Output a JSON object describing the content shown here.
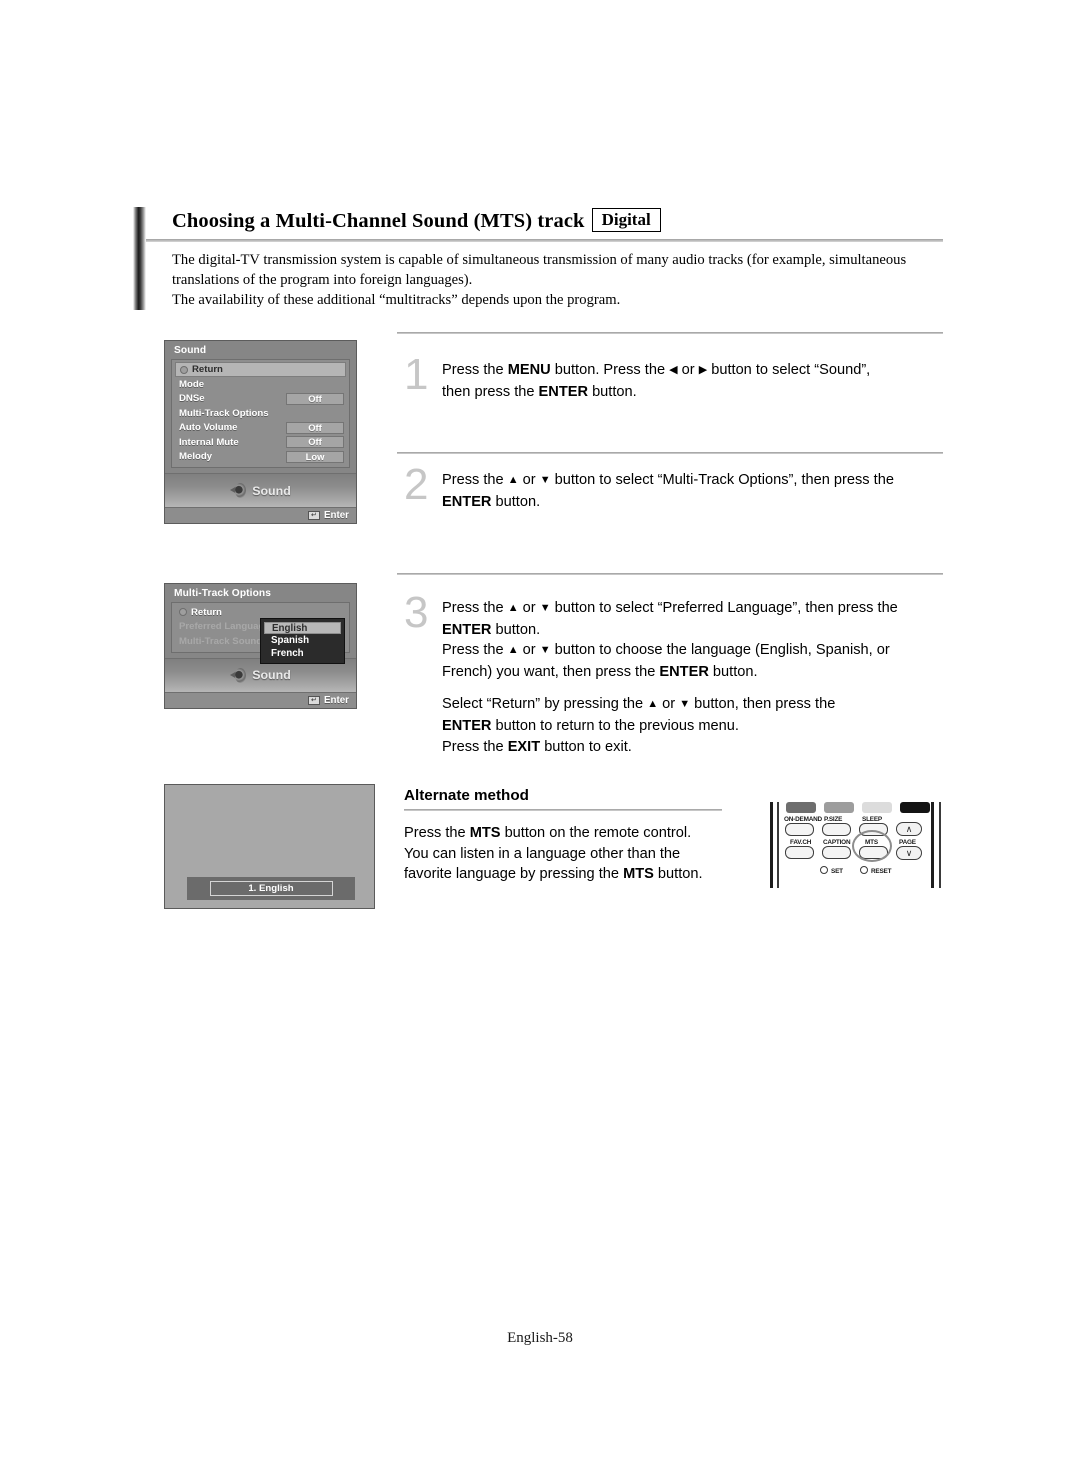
{
  "document": {
    "title": "Choosing a Multi-Channel Sound (MTS) track",
    "badge": "Digital",
    "intro_line1": "The digital-TV transmission system is capable of simultaneous transmission of many audio tracks (for example, simultaneous",
    "intro_line2": "translations of the program into foreign languages).",
    "intro_line3": "The availability of these additional “multitracks” depends upon the program.",
    "footer": "English-58"
  },
  "steps": [
    {
      "number": "1",
      "lines": [
        {
          "parts": [
            {
              "t": "Press the ",
              "b": false
            },
            {
              "t": "MENU",
              "b": true
            },
            {
              "t": " button. Press the ",
              "b": false
            },
            {
              "t": "◀",
              "b": false,
              "arrow": true
            },
            {
              "t": "  or  ",
              "b": false
            },
            {
              "t": "▶",
              "b": false,
              "arrow": true
            },
            {
              "t": "  button to select “Sound”,",
              "b": false
            }
          ]
        },
        {
          "parts": [
            {
              "t": "then press the ",
              "b": false
            },
            {
              "t": "ENTER",
              "b": true
            },
            {
              "t": " button.",
              "b": false
            }
          ]
        }
      ]
    },
    {
      "number": "2",
      "lines": [
        {
          "parts": [
            {
              "t": "Press the ",
              "b": false
            },
            {
              "t": "▲",
              "b": false,
              "arrow": true
            },
            {
              "t": " or ",
              "b": false
            },
            {
              "t": "▼",
              "b": false,
              "arrow": true
            },
            {
              "t": " button to select “Multi-Track Options”, then press the",
              "b": false
            }
          ]
        },
        {
          "parts": [
            {
              "t": "ENTER",
              "b": true
            },
            {
              "t": " button.",
              "b": false
            }
          ]
        }
      ]
    },
    {
      "number": "3",
      "lines": [
        {
          "parts": [
            {
              "t": "Press the ",
              "b": false
            },
            {
              "t": "▲",
              "b": false,
              "arrow": true
            },
            {
              "t": " or ",
              "b": false
            },
            {
              "t": "▼",
              "b": false,
              "arrow": true
            },
            {
              "t": " button to select “Preferred Language”, then press the",
              "b": false
            }
          ]
        },
        {
          "parts": [
            {
              "t": "ENTER",
              "b": true
            },
            {
              "t": " button.",
              "b": false
            }
          ]
        },
        {
          "parts": [
            {
              "t": "Press the ",
              "b": false
            },
            {
              "t": "▲",
              "b": false,
              "arrow": true
            },
            {
              "t": " or ",
              "b": false
            },
            {
              "t": "▼",
              "b": false,
              "arrow": true
            },
            {
              "t": " button to choose the language (English, Spanish, or",
              "b": false
            }
          ]
        },
        {
          "parts": [
            {
              "t": "French) you want, then press the ",
              "b": false
            },
            {
              "t": "ENTER",
              "b": true
            },
            {
              "t": " button.",
              "b": false
            }
          ]
        },
        {
          "gap": true
        },
        {
          "parts": [
            {
              "t": "Select “Return” by pressing the ",
              "b": false
            },
            {
              "t": "▲",
              "b": false,
              "arrow": true
            },
            {
              "t": " or ",
              "b": false
            },
            {
              "t": "▼",
              "b": false,
              "arrow": true
            },
            {
              "t": " button, then press the",
              "b": false
            }
          ]
        },
        {
          "parts": [
            {
              "t": "ENTER",
              "b": true
            },
            {
              "t": " button to return to the previous menu.",
              "b": false
            }
          ]
        },
        {
          "parts": [
            {
              "t": "Press the ",
              "b": false
            },
            {
              "t": "EXIT",
              "b": true
            },
            {
              "t": " button to exit.",
              "b": false
            }
          ]
        }
      ]
    }
  ],
  "alternate_method": {
    "title": "Alternate method",
    "lines": [
      {
        "parts": [
          {
            "t": "Press the ",
            "b": false
          },
          {
            "t": "MTS",
            "b": true
          },
          {
            "t": " button on the remote control.",
            "b": false
          }
        ]
      },
      {
        "parts": [
          {
            "t": "You can listen in a language other than the",
            "b": false
          }
        ]
      },
      {
        "parts": [
          {
            "t": "favorite language by pressing the ",
            "b": false
          },
          {
            "t": "MTS",
            "b": true
          },
          {
            "t": " button.",
            "b": false
          }
        ]
      }
    ]
  },
  "sound_menu": {
    "title": "Sound",
    "rows": [
      {
        "label": "Return",
        "value": null,
        "selected": true,
        "icon": "return-icon"
      },
      {
        "label": "Mode",
        "value": null,
        "selected": false
      },
      {
        "label": "DNSe",
        "value": "Off",
        "selected": false
      },
      {
        "label": "Multi-Track Options",
        "value": null,
        "selected": false
      },
      {
        "label": "Auto Volume",
        "value": "Off",
        "selected": false
      },
      {
        "label": "Internal Mute",
        "value": "Off",
        "selected": false
      },
      {
        "label": "Melody",
        "value": "Low",
        "selected": false
      }
    ],
    "footer_word": "Sound",
    "enter_label": "Enter"
  },
  "multitrack_menu": {
    "title": "Multi-Track Options",
    "rows": [
      {
        "label": "Return",
        "dim": false,
        "icon": "return-icon"
      },
      {
        "label": "Preferred Language",
        "dim": true
      },
      {
        "label": "Multi-Track Sound",
        "dim": true
      }
    ],
    "dropdown": [
      {
        "label": "English",
        "selected": true
      },
      {
        "label": "Spanish",
        "selected": false
      },
      {
        "label": "French",
        "selected": false
      }
    ],
    "footer_word": "Sound",
    "enter_label": "Enter"
  },
  "tv_screen": {
    "banner_text": "1. English"
  },
  "remote": {
    "top_buttons": [
      {
        "label": "ON-DEMAND",
        "color": "#6e6e6e"
      },
      {
        "label": "P.SIZE",
        "color": "#9d9d9d"
      },
      {
        "label": "SLEEP",
        "color": "#dcdcdc"
      },
      {
        "label": "",
        "color": "#141414"
      }
    ],
    "bottom_labels": [
      "FAV.CH",
      "CAPTION",
      "MTS",
      "PAGE"
    ],
    "page_up": "∧",
    "page_down": "∨",
    "set_label": "SET",
    "reset_label": "RESET"
  }
}
